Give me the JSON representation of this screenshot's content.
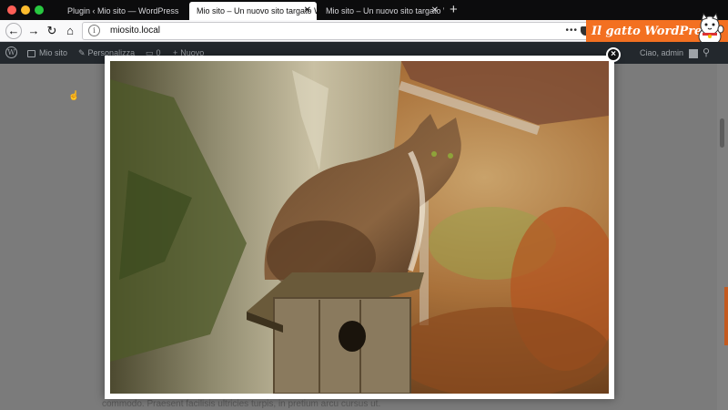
{
  "browser": {
    "tabs": [
      {
        "label": "Plugin ‹ Mio sito — WordPress",
        "active": false
      },
      {
        "label": "Mio sito – Un nuovo sito targato Wo",
        "active": true
      },
      {
        "label": "Mio sito – Un nuovo sito targato Wo",
        "active": false
      }
    ],
    "tab_close_glyph": "✕",
    "new_tab_glyph": "+",
    "url": "miosito.local",
    "more_glyph": "•••",
    "nav_glyphs": {
      "back": "←",
      "forward": "→",
      "reload": "↻",
      "home": "⌂"
    }
  },
  "brand": {
    "text": "Il gatto WordPress",
    "color": "#f37021"
  },
  "adminbar": {
    "site_name": "Mio sito",
    "customize": "Personalizza",
    "comments_count": "0",
    "new_label": "Nuovo",
    "greeting": "Ciao, admin"
  },
  "page": {
    "paragraph_fragment": "commodo. Praesent facilisis ultricies turpis, in pretium arcu cursus ut."
  },
  "lightbox": {
    "close_glyph": "×",
    "image_subject": "tabby cat sitting on a wooden birdhouse beside a tree trunk"
  },
  "icons": [
    "back-arrow-icon",
    "forward-arrow-icon",
    "reload-icon",
    "home-icon",
    "info-icon",
    "more-actions-icon",
    "pocket-icon",
    "wordpress-logo-icon",
    "paintbrush-icon",
    "comment-icon",
    "plus-icon",
    "avatar-icon",
    "search-icon",
    "close-icon",
    "cat-mascot-icon",
    "cursor-icon"
  ],
  "colors": {
    "tab_strip": "#0c0c0d",
    "admin_bar": "#23282d",
    "overlay_page": "#7b7b7b",
    "accent_orange": "#f37021"
  }
}
